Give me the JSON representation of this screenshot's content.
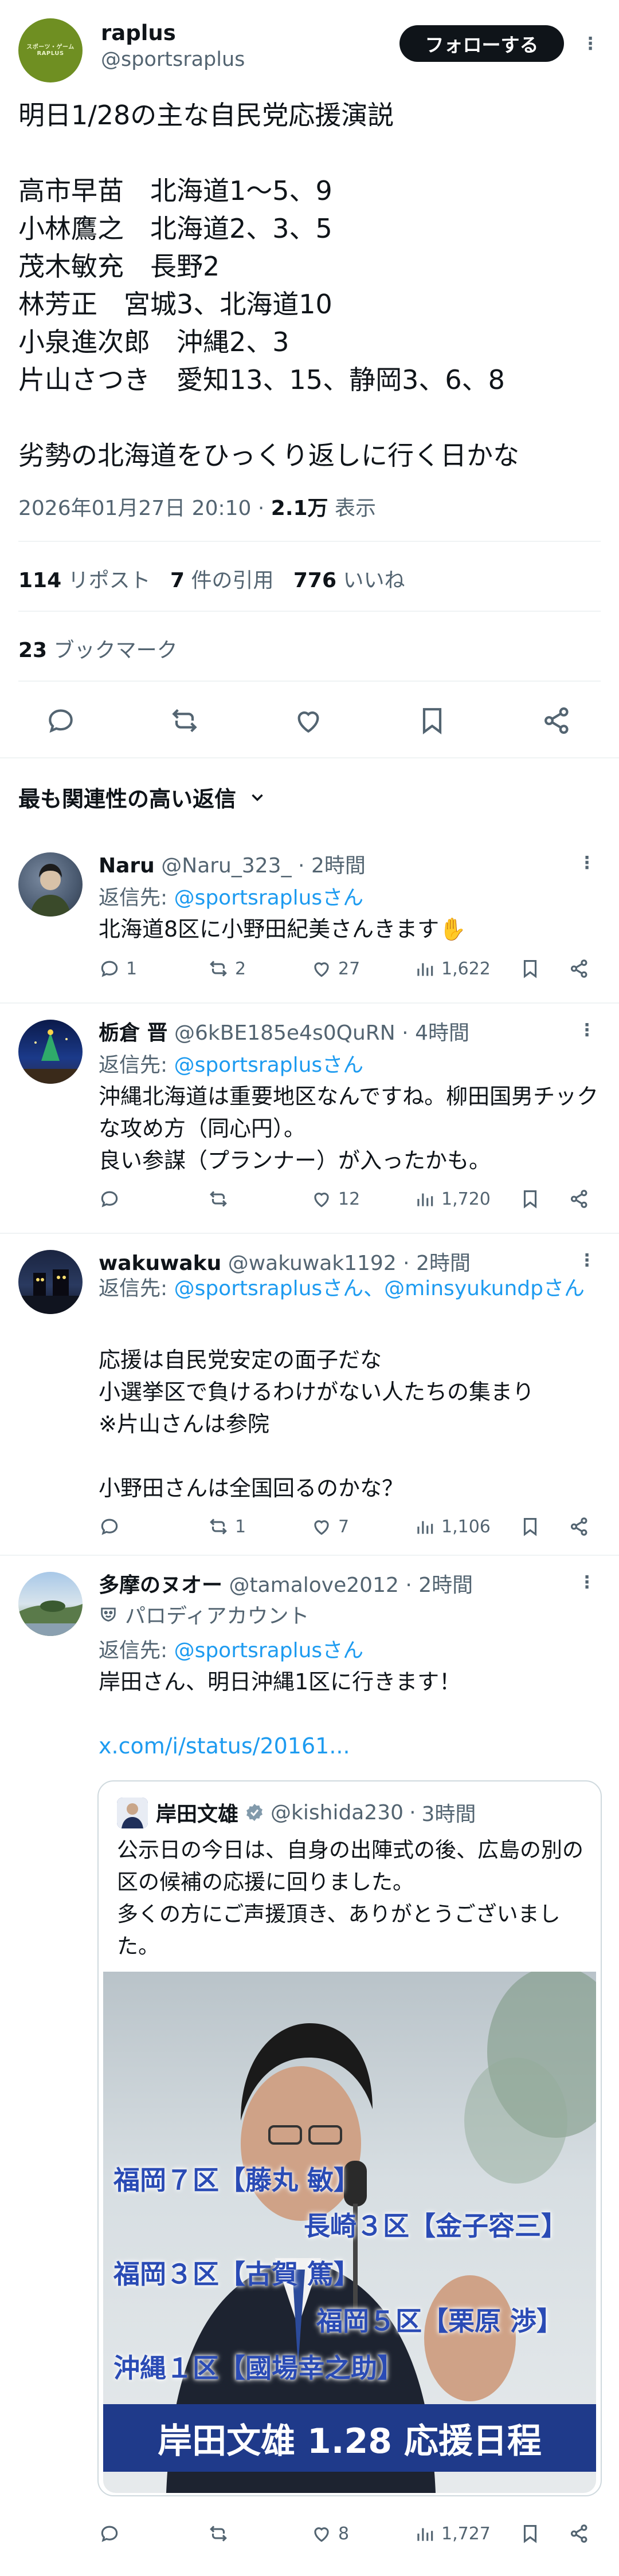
{
  "tweet": {
    "name": "raplus",
    "handle": "@sportsraplus",
    "follow_label": "フォローする",
    "text": "明日1/28の主な自民党応援演説\n\n高市早苗　北海道1〜5、9\n小林鷹之　北海道2、3、5\n茂木敏充　長野2\n林芳正　宮城3、北海道10\n小泉進次郎　沖縄2、3\n片山さつき　愛知13、15、静岡3、6、8\n\n劣勢の北海道をひっくり返しに行く日かな",
    "datetime": "2026年01月27日 20:10",
    "views": "2.1万",
    "views_label": "表示",
    "reposts": "114",
    "reposts_label": "リポスト",
    "quotes": "7",
    "quotes_label": "件の引用",
    "likes": "776",
    "likes_label": "いいね",
    "bookmarks": "23",
    "bookmarks_label": "ブックマーク",
    "avatar_logo": "スポーツ・ゲーム RAPLUS"
  },
  "sort_label": "最も関連性の高い返信",
  "replies": [
    {
      "name": "Naru",
      "handle": "@Naru_323_",
      "time": "2時間",
      "reply_to_prefix": "返信先: ",
      "reply_to": "@sportsraplusさん",
      "text": "北海道8区に小野田紀美さんきます✋",
      "replies": "1",
      "reposts": "2",
      "likes": "27",
      "views": "1,622"
    },
    {
      "name": "栃倉 晋",
      "handle": "@6kBE185e4s0QuRN",
      "time": "4時間",
      "reply_to_prefix": "返信先: ",
      "reply_to": "@sportsraplusさん",
      "text": "沖縄北海道は重要地区なんですね。柳田国男チックな攻め方（同心円）。\n良い参謀（プランナー）が入ったかも。",
      "replies": "",
      "reposts": "",
      "likes": "12",
      "views": "1,720"
    },
    {
      "name": "wakuwaku",
      "handle": "@wakuwak1192",
      "time": "2時間",
      "reply_to_prefix": "返信先: ",
      "reply_to": "@sportsraplusさん、@minsyukundpさん",
      "text": "応援は自民党安定の面子だな\n小選挙区で負けるわけがない人たちの集まり\n※片山さんは参院\n\n小野田さんは全国回るのかな？",
      "replies": "",
      "reposts": "1",
      "likes": "7",
      "views": "1,106"
    },
    {
      "name": "多摩のヌオー",
      "handle": "@tamalove2012",
      "time": "2時間",
      "parody_label": "パロディアカウント",
      "reply_to_prefix": "返信先: ",
      "reply_to": "@sportsraplusさん",
      "text": "岸田さん、明日沖縄1区に行きます！",
      "link": "x.com/i/status/20161...",
      "replies": "",
      "reposts": "",
      "likes": "8",
      "views": "1,727",
      "quote": {
        "name": "岸田文雄",
        "handle": "@kishida230",
        "time": "3時間",
        "text": "公示日の今日は、自身の出陣式の後、広島の別の区の候補の応援に回りました。\n多くの方にご声援頂き、ありがとうございました。\n…",
        "image_lines": [
          "福岡７区【藤丸 敏】",
          "長崎３区【金子容三】",
          "福岡３区【古賀 篤】",
          "福岡５区【栗原 渉】",
          "沖縄１区【國場幸之助】"
        ],
        "image_banner": "岸田文雄 1.28 応援日程"
      }
    }
  ],
  "colors": {
    "link": "#1d9bf0",
    "muted": "#536471",
    "banner": "#1f3a8a",
    "image_text": "#2a4bb5"
  }
}
